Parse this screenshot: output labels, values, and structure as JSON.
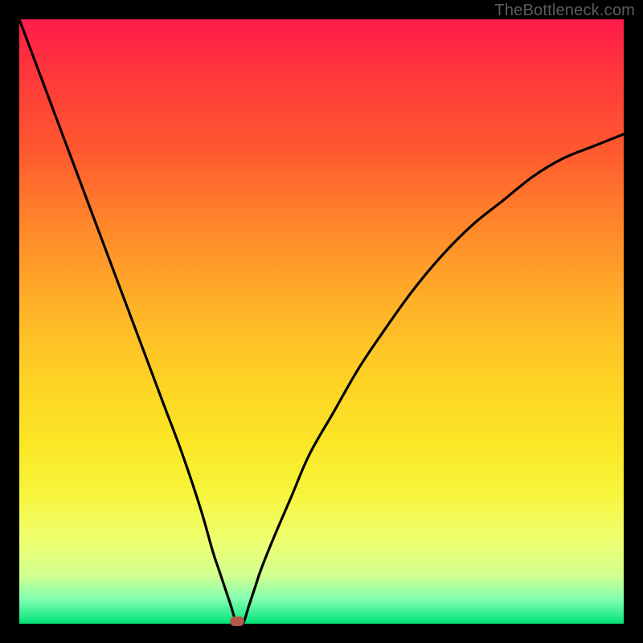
{
  "watermark": "TheBottleneck.com",
  "colors": {
    "frame": "#000000",
    "curve": "#000000",
    "marker": "#b15a4a",
    "gradient_top": "#ff1b4b",
    "gradient_bottom": "#00e27a"
  },
  "chart_data": {
    "type": "line",
    "title": "",
    "xlabel": "",
    "ylabel": "",
    "xlim": [
      0,
      100
    ],
    "ylim": [
      0,
      100
    ],
    "grid": false,
    "legend": false,
    "annotations": [
      "TheBottleneck.com"
    ],
    "minimum_at_x": 36,
    "minimum_marker": {
      "x": 36,
      "y": 0
    },
    "series": [
      {
        "name": "bottleneck-curve",
        "x": [
          0,
          3,
          6,
          9,
          12,
          15,
          18,
          21,
          24,
          27,
          30,
          32,
          33,
          34,
          35,
          36,
          37,
          38,
          39,
          40,
          42,
          45,
          48,
          52,
          56,
          60,
          65,
          70,
          75,
          80,
          85,
          90,
          95,
          100
        ],
        "y": [
          100,
          92,
          84,
          76,
          68,
          60,
          52,
          44,
          36,
          28,
          19,
          12,
          9,
          6,
          3,
          0,
          0,
          3,
          6,
          9,
          14,
          21,
          28,
          35,
          42,
          48,
          55,
          61,
          66,
          70,
          74,
          77,
          79,
          81
        ]
      }
    ]
  }
}
